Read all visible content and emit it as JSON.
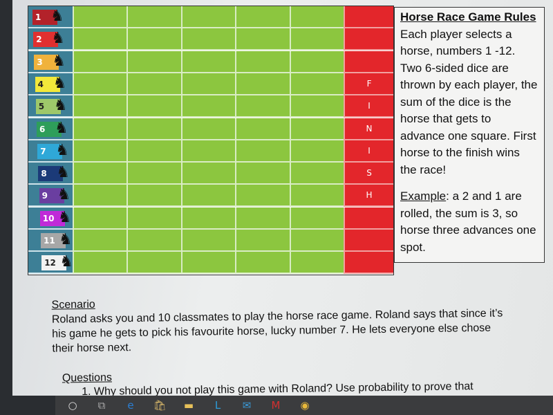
{
  "board": {
    "lanes": [
      {
        "num": "1",
        "color": "#b3222a"
      },
      {
        "num": "2",
        "color": "#e03030"
      },
      {
        "num": "3",
        "color": "#f0b23c"
      },
      {
        "num": "4",
        "color": "#f3e83a"
      },
      {
        "num": "5",
        "color": "#9ec86a"
      },
      {
        "num": "6",
        "color": "#2e9e5a"
      },
      {
        "num": "7",
        "color": "#2fa8d8"
      },
      {
        "num": "8",
        "color": "#1b3a78"
      },
      {
        "num": "9",
        "color": "#6a3ea0"
      },
      {
        "num": "10",
        "color": "#c02ad8"
      },
      {
        "num": "11",
        "color": "#a7a7a7"
      },
      {
        "num": "12",
        "color": "#f2f2f2"
      }
    ],
    "finish_letters": [
      "",
      "",
      "",
      "F",
      "I",
      "N",
      "I",
      "S",
      "H",
      "",
      "",
      ""
    ],
    "icon": "horse-head-icon"
  },
  "rules": {
    "title": "Horse Race Game Rules",
    "body": "Each player selects a horse, numbers 1 -12. Two 6-sided dice are thrown by each player, the sum of the dice is the horse that gets to advance one square. First horse to the finish wins the race!",
    "example_label": "Example",
    "example_text": ": a 2 and 1 are rolled, the sum is 3, so horse three advances one spot."
  },
  "scenario": {
    "heading": "Scenario",
    "text": "Roland asks you and 10 classmates to play the horse race game.  Roland says that since it’s his game he gets to pick his favourite horse, lucky number 7.  He lets everyone else chose their horse next."
  },
  "questions": {
    "heading": "Questions",
    "q1": "1.  Why should you not play this game with Roland?  Use probability to prove that"
  },
  "taskbar": {
    "icons": [
      "search-circle-icon",
      "task-view-icon",
      "edge-icon",
      "store-icon",
      "file-explorer-icon",
      "l-app-icon",
      "mail-icon",
      "mcafee-icon",
      "chrome-icon"
    ],
    "glyphs": [
      "○",
      "⧉",
      "e",
      "🛍",
      "▬",
      "L",
      "✉",
      "M",
      "◉"
    ],
    "colors": [
      "#ddd",
      "#aaa",
      "#2a7fd4",
      "#d9b86a",
      "#e8c25a",
      "#2d9bd8",
      "#3a9ad8",
      "#d23030",
      "#e8b83a"
    ]
  }
}
